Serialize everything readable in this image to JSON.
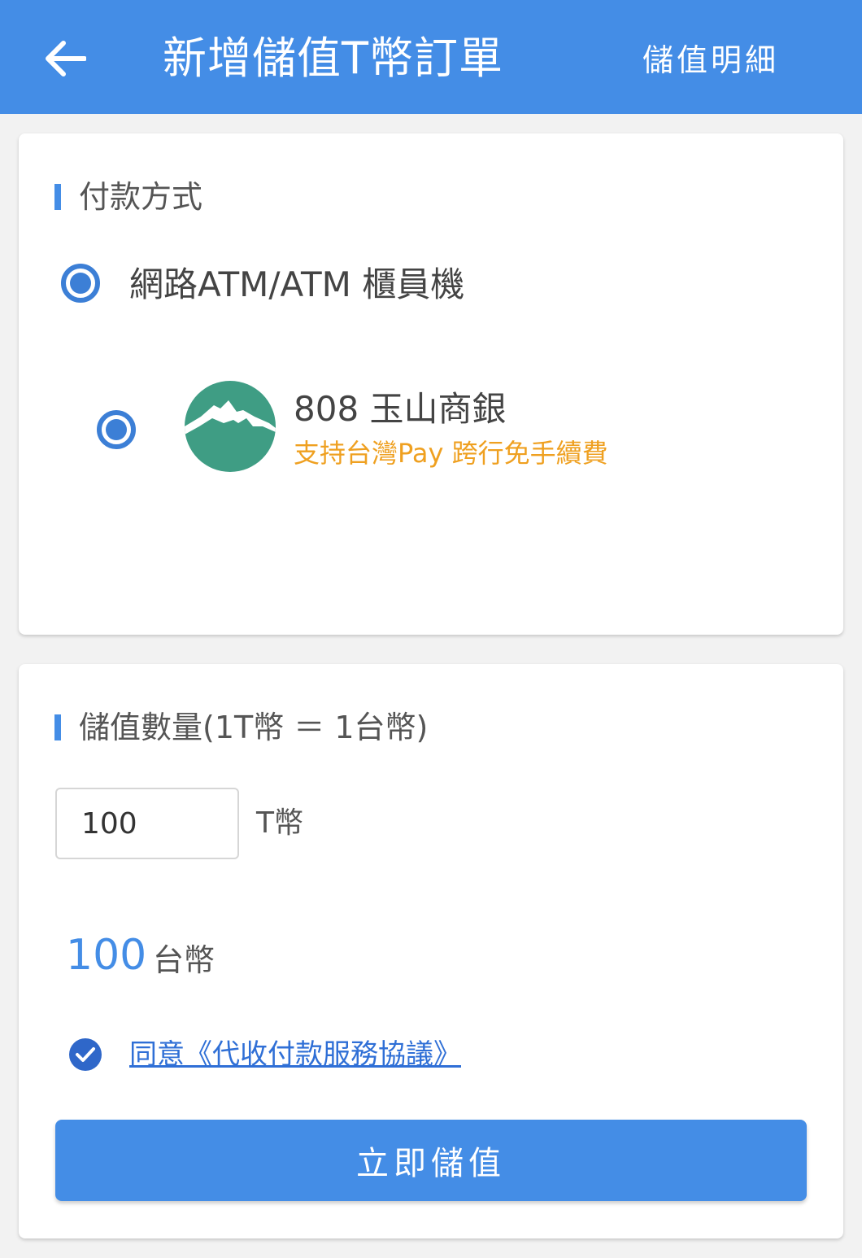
{
  "header": {
    "title": "新增儲值T幣訂單",
    "action_label": "儲值明細",
    "background_color": "#448de6",
    "back_icon": "arrow-left-icon"
  },
  "payment": {
    "section_title": "付款方式",
    "method": {
      "label": "網路ATM/ATM 櫃員機",
      "selected": true
    },
    "bank": {
      "name": "808 玉山商銀",
      "note": "支持台灣Pay 跨行免手續費",
      "selected": true,
      "logo_icon": "mountain-logo-icon"
    }
  },
  "amount": {
    "section_title": "儲值數量(1T幣 ＝ 1台幣)",
    "input_value": "100",
    "unit": "T幣",
    "total_value": "100",
    "total_unit": "台幣",
    "agreement_label": "同意《代收付款服務協議》",
    "agreement_checked": true,
    "submit_label": "立即儲值"
  },
  "colors": {
    "accent": "#448de6",
    "note": "#efa020",
    "link": "#2f6fd6",
    "bank_logo": "#3f9d84"
  }
}
